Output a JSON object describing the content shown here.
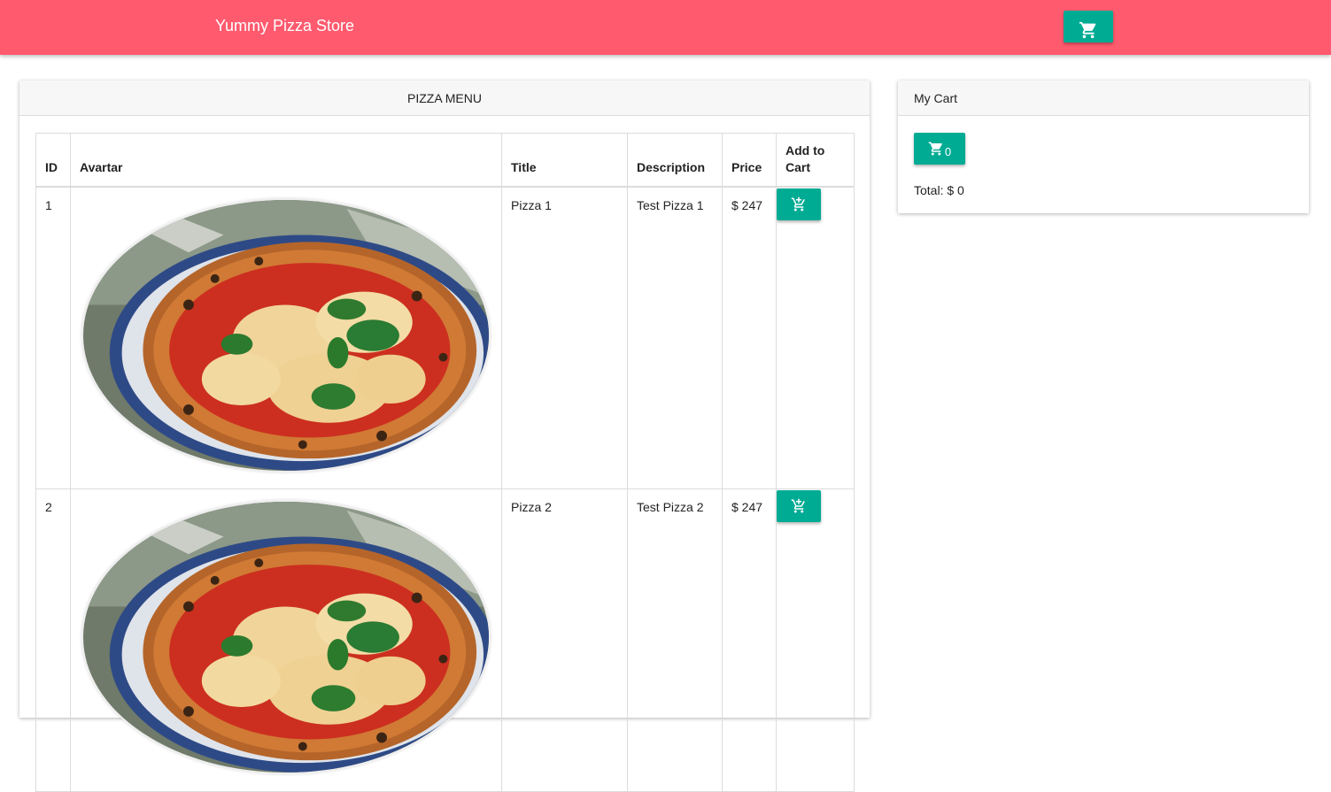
{
  "header": {
    "brand": "Yummy Pizza Store",
    "cart_icon": "cart-icon"
  },
  "menu": {
    "title": "PIZZA MENU",
    "columns": [
      "ID",
      "Avartar",
      "Title",
      "Description",
      "Price",
      "Add to Cart"
    ],
    "rows": [
      {
        "id": "1",
        "title": "Pizza 1",
        "description": "Test Pizza 1",
        "price": "$ 247",
        "add_icon": "add-to-cart-icon"
      },
      {
        "id": "2",
        "title": "Pizza 2",
        "description": "Test Pizza 2",
        "price": "$ 247",
        "add_icon": "add-to-cart-icon"
      }
    ]
  },
  "cart": {
    "title": "My Cart",
    "count": "0",
    "total": "Total: $ 0"
  },
  "colors": {
    "navbar": "#ff5a6e",
    "accent": "#00ab94"
  }
}
